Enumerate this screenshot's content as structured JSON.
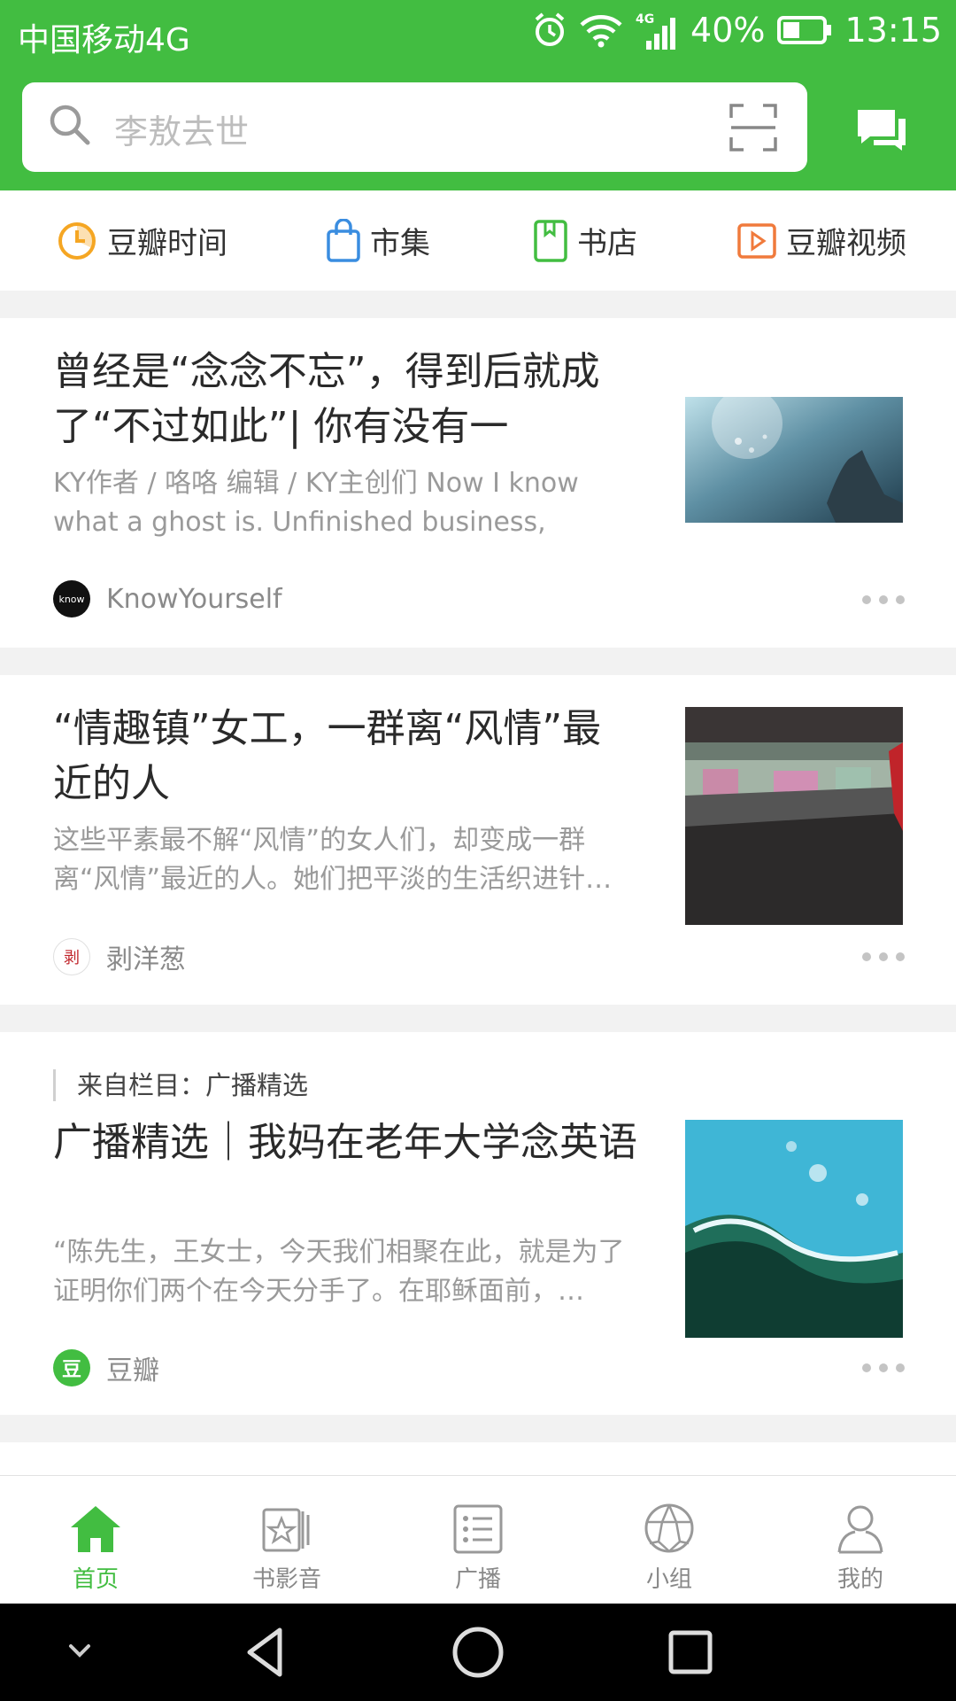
{
  "status": {
    "carrier": "中国移动4G",
    "network": "4G",
    "battery": "40%",
    "time": "13:15"
  },
  "search": {
    "placeholder": "李敖去世"
  },
  "quicknav": [
    {
      "label": "豆瓣时间",
      "icon": "clock-icon"
    },
    {
      "label": "市集",
      "icon": "shopping-bag-icon"
    },
    {
      "label": "书店",
      "icon": "book-icon"
    },
    {
      "label": "豆瓣视频",
      "icon": "video-play-icon"
    }
  ],
  "cards": [
    {
      "title": "曾经是“念念不忘”，得到后就成了“不过如此”| 你有没有一件“未…",
      "desc": "KY作者 / 咯咯 编辑 / KY主创们 Now I know what a ghost is. Unfinished business, that’s w…",
      "author": "KnowYourself",
      "avatar_text": "know"
    },
    {
      "title": "“情趣镇”女工，一群离“风情”最近的人",
      "desc": "这些平素最不解“风情”的女人们，却变成一群离“风情”最近的人。她们把平淡的生活织进针…",
      "author": "剥洋葱",
      "avatar_text": "剥"
    },
    {
      "column": "来自栏目：广播精选",
      "title": "广播精选｜我妈在老年大学念英语",
      "desc": "“陈先生，王女士，今天我们相聚在此，就是为了证明你们两个在今天分手了。在耶稣面前，…",
      "author": "豆瓣",
      "avatar_text": "豆"
    }
  ],
  "tabs": [
    {
      "label": "首页",
      "icon": "home-icon",
      "active": true
    },
    {
      "label": "书影音",
      "icon": "media-star-icon",
      "active": false
    },
    {
      "label": "广播",
      "icon": "broadcast-list-icon",
      "active": false
    },
    {
      "label": "小组",
      "icon": "group-ball-icon",
      "active": false
    },
    {
      "label": "我的",
      "icon": "profile-icon",
      "active": false
    }
  ],
  "colors": {
    "brand_green": "#42bd41",
    "text_dark": "#2a2a2a",
    "text_muted": "#9a9a9a"
  }
}
